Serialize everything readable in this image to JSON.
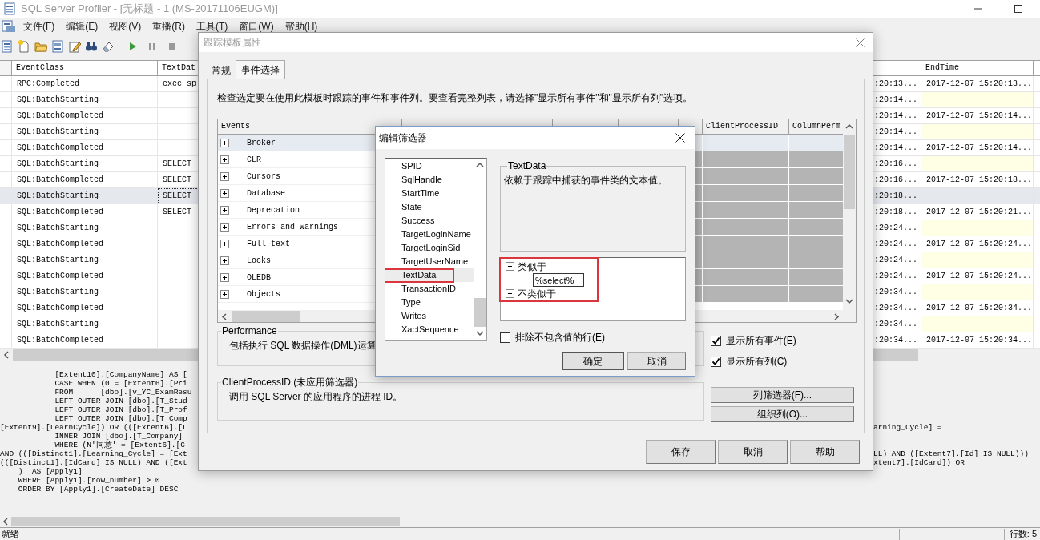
{
  "window": {
    "title": "SQL Server Profiler - [无标题 - 1 (MS-20171106EUGM)]"
  },
  "menu": [
    "文件(F)",
    "编辑(E)",
    "视图(V)",
    "重播(R)",
    "工具(T)",
    "窗口(W)",
    "帮助(H)"
  ],
  "trace_table": {
    "columns": [
      {
        "label": "EventClass"
      },
      {
        "label": "TextDat"
      },
      {},
      {
        "label": "EndTime"
      }
    ],
    "rows": [
      {
        "event_class": "RPC:Completed",
        "text_data": "exec sp",
        "column_3": ":20:13...",
        "end_time": "2017-12-07 15:20:13...",
        "selected": false
      },
      {
        "event_class": "SQL:BatchStarting",
        "column_3": ":20:14...",
        "selected": false
      },
      {
        "event_class": "SQL:BatchCompleted",
        "column_3": ":20:14...",
        "end_time": "2017-12-07 15:20:14...",
        "selected": false
      },
      {
        "event_class": "SQL:BatchStarting",
        "column_3": ":20:14...",
        "selected": false
      },
      {
        "event_class": "SQL:BatchCompleted",
        "column_3": ":20:14...",
        "end_time": "2017-12-07 15:20:14...",
        "selected": false
      },
      {
        "event_class": "SQL:BatchStarting",
        "text_data": "SELECT",
        "column_3": ":20:16...",
        "selected": false
      },
      {
        "event_class": "SQL:BatchCompleted",
        "text_data": "SELECT",
        "column_3": ":20:16...",
        "end_time": "2017-12-07 15:20:18...",
        "selected": false
      },
      {
        "event_class": "SQL:BatchStarting",
        "text_data": "SELECT",
        "column_3": ":20:18...",
        "selected": true
      },
      {
        "event_class": "SQL:BatchCompleted",
        "text_data": "SELECT",
        "column_3": ":20:18...",
        "end_time": "2017-12-07 15:20:21...",
        "selected": false
      },
      {
        "event_class": "SQL:BatchStarting",
        "column_3": ":20:24...",
        "selected": false
      },
      {
        "event_class": "SQL:BatchCompleted",
        "column_3": ":20:24...",
        "end_time": "2017-12-07 15:20:24...",
        "selected": false
      },
      {
        "event_class": "SQL:BatchStarting",
        "column_3": ":20:24...",
        "selected": false
      },
      {
        "event_class": "SQL:BatchCompleted",
        "column_3": ":20:24...",
        "end_time": "2017-12-07 15:20:24...",
        "selected": false
      },
      {
        "event_class": "SQL:BatchStarting",
        "column_3": ":20:34...",
        "selected": false
      },
      {
        "event_class": "SQL:BatchCompleted",
        "column_3": ":20:34...",
        "end_time": "2017-12-07 15:20:34...",
        "selected": false
      },
      {
        "event_class": "SQL:BatchStarting",
        "column_3": ":20:34...",
        "selected": false
      },
      {
        "event_class": "SQL:BatchCompleted",
        "column_3": ":20:34...",
        "end_time": "2017-12-07 15:20:34...",
        "selected": false
      }
    ]
  },
  "sql_text": {
    "lines": [
      {
        "text": "            [Extent10].[CompanyName] AS ["
      },
      {
        "text": "            CASE WHEN (0 = [Extent6].[Pri"
      },
      {
        "text": "            FROM      [dbo].[v_YC_ExamResu"
      },
      {
        "text": "            LEFT OUTER JOIN [dbo].[T_Stud"
      },
      {
        "text": "            LEFT OUTER JOIN [dbo].[T_Prof"
      },
      {
        "text": "            LEFT OUTER JOIN [dbo].[T_Comp"
      },
      {
        "text": "[Extent9].[LearnCycle]) OR (([Extent6].[L",
        "right_text": "arning_Cycle] ="
      },
      {
        "text": "            INNER JOIN [dbo].[T_Company]"
      },
      {
        "text": "            WHERE (N'同意' = [Extent6].[C"
      },
      {
        "text": "AND (([Distinct1].[Learning_Cycle] = [Ext",
        "right_text": "LL) AND ([Extent7].[Id] IS NULL)))"
      },
      {
        "text": "(([Distinct1].[IdCard] IS NULL) AND ([Ext",
        "right_text": "xtent7].[IdCard]) OR"
      },
      {
        "text": "    )  AS [Apply1]"
      },
      {
        "text": "    WHERE [Apply1].[row_number] > 0"
      },
      {
        "text": "    ORDER BY [Apply1].[CreateDate] DESC"
      }
    ]
  },
  "status_bar": {
    "text": "就绪",
    "row_count": "行数: 5"
  },
  "trace_dialog": {
    "title": "跟踪模板属性",
    "tabs": [
      {
        "label": "常规",
        "selected": false
      },
      {
        "label": "事件选择",
        "selected": true
      }
    ],
    "description": "检查选定要在使用此模板时跟踪的事件和事件列。要查看完整列表，请选择\"显示所有事件\"和\"显示所有列\"选项。",
    "events_grid": {
      "columns": [
        {
          "label": "Events"
        },
        {},
        {},
        {},
        {},
        {},
        {
          "label": "ClientProcessID"
        },
        {
          "label": "ColumnPerm"
        }
      ],
      "rows": [
        {
          "name": "Broker",
          "expanded": false,
          "selected": true
        },
        {
          "name": "CLR",
          "expanded": false,
          "selected": false
        },
        {
          "name": "Cursors",
          "expanded": false,
          "selected": false
        },
        {
          "name": "Database",
          "expanded": false,
          "selected": false
        },
        {
          "name": "Deprecation",
          "expanded": false,
          "selected": false
        },
        {
          "name": "Errors and Warnings",
          "expanded": false,
          "selected": false
        },
        {
          "name": "Full text",
          "expanded": false,
          "selected": false
        },
        {
          "name": "Locks",
          "expanded": false,
          "selected": false
        },
        {
          "name": "OLEDB",
          "expanded": false,
          "selected": false
        },
        {
          "name": "Objects",
          "expanded": false,
          "selected": false
        }
      ]
    },
    "event_info": {
      "title": "Performance",
      "text": "包括执行 SQL 数据操作(DML)运算"
    },
    "column_info": {
      "title": "ClientProcessID (未应用筛选器)",
      "text": "调用 SQL Server 的应用程序的进程 ID。"
    },
    "options": [
      {
        "label": "显示所有事件(E)",
        "checked": true
      },
      {
        "label": "显示所有列(C)",
        "checked": true
      }
    ],
    "column_buttons": [
      "列筛选器(F)...",
      "组织列(O)..."
    ],
    "buttons": [
      "保存",
      "取消",
      "帮助"
    ]
  },
  "filter_dialog": {
    "title": "编辑筛选器",
    "fields": [
      {
        "label": "SPID",
        "selected": false,
        "highlighted": false
      },
      {
        "label": "SqlHandle",
        "selected": false,
        "highlighted": false
      },
      {
        "label": "StartTime",
        "selected": false,
        "highlighted": false
      },
      {
        "label": "State",
        "selected": false,
        "highlighted": false
      },
      {
        "label": "Success",
        "selected": false,
        "highlighted": false
      },
      {
        "label": "TargetLoginName",
        "selected": false,
        "highlighted": false
      },
      {
        "label": "TargetLoginSid",
        "selected": false,
        "highlighted": false
      },
      {
        "label": "TargetUserName",
        "selected": false,
        "highlighted": false
      },
      {
        "label": "TextData",
        "selected": true,
        "highlighted": true
      },
      {
        "label": "TransactionID",
        "selected": false,
        "highlighted": false
      },
      {
        "label": "Type",
        "selected": false,
        "highlighted": false
      },
      {
        "label": "Writes",
        "selected": false,
        "highlighted": false
      },
      {
        "label": "XactSequence",
        "selected": false,
        "highlighted": false
      }
    ],
    "info": {
      "title": "TextData",
      "text": "依赖于跟踪中捕获的事件类的文本值。"
    },
    "conditions": {
      "highlighted": true,
      "items": [
        {
          "label": "类似于",
          "expanded": true,
          "values": [
            "%select%"
          ]
        },
        {
          "label": "不类似于",
          "expanded": false
        }
      ]
    },
    "exclude_option": {
      "label": "排除不包含值的行(E)",
      "checked": false
    },
    "buttons": [
      {
        "label": "确定",
        "default": true
      },
      {
        "label": "取消",
        "default": false
      }
    ]
  }
}
